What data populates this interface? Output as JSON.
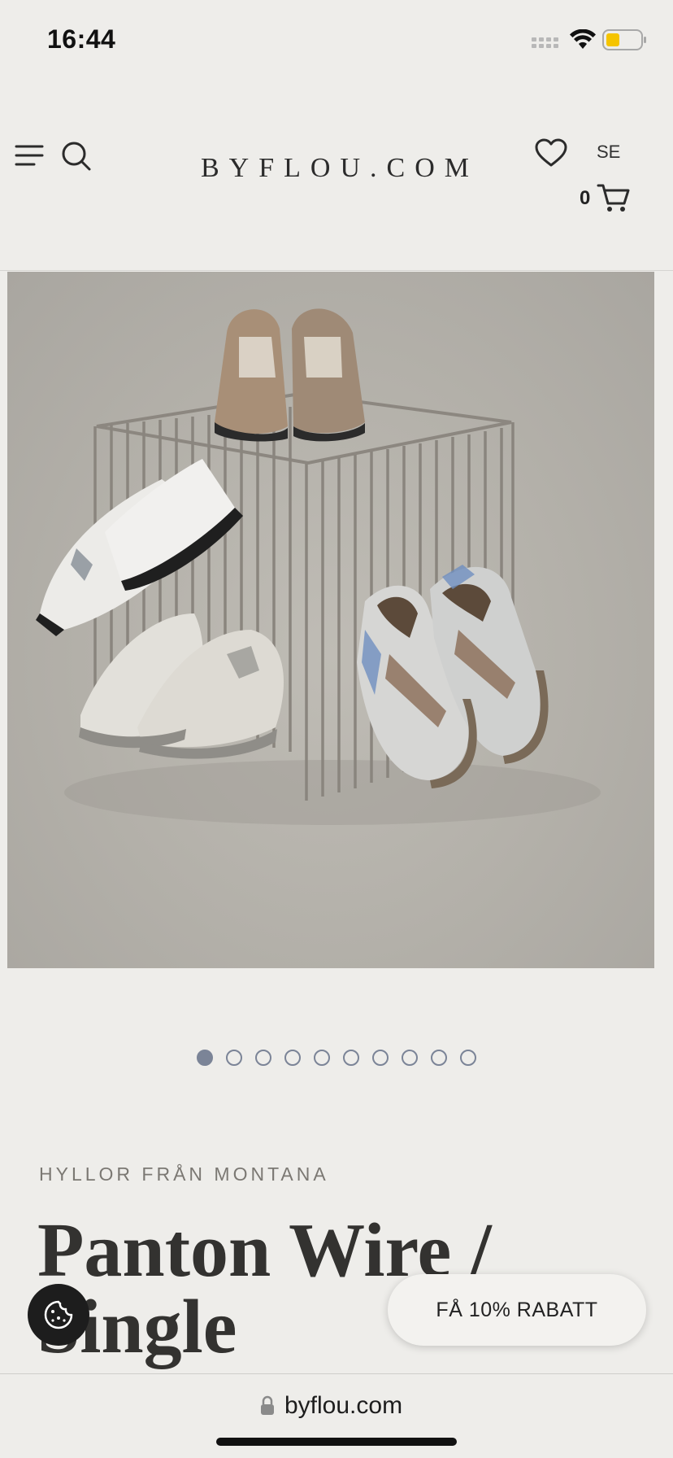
{
  "status_bar": {
    "time": "16:44",
    "icons": [
      "signal-icon",
      "wifi-icon",
      "battery-icon"
    ]
  },
  "header": {
    "logo": "BYFLOU.COM",
    "locale": "SE",
    "cart_count": "0",
    "icons": [
      "menu-icon",
      "search-icon",
      "heart-icon",
      "cart-icon"
    ]
  },
  "gallery": {
    "image_count": 10,
    "active_index": 0
  },
  "product": {
    "brand_line": "HYLLOR FRÅN MONTANA",
    "title": "Panton Wire / Single"
  },
  "floating": {
    "discount_label": "FÅ 10% RABATT",
    "cookie_icon": "cookie-icon"
  },
  "browser": {
    "url": "byflou.com"
  },
  "colors": {
    "background": "#eeedea",
    "dot": "#7b8497",
    "cookie_button": "#1d1d1d",
    "battery_fill": "#f5c400"
  }
}
